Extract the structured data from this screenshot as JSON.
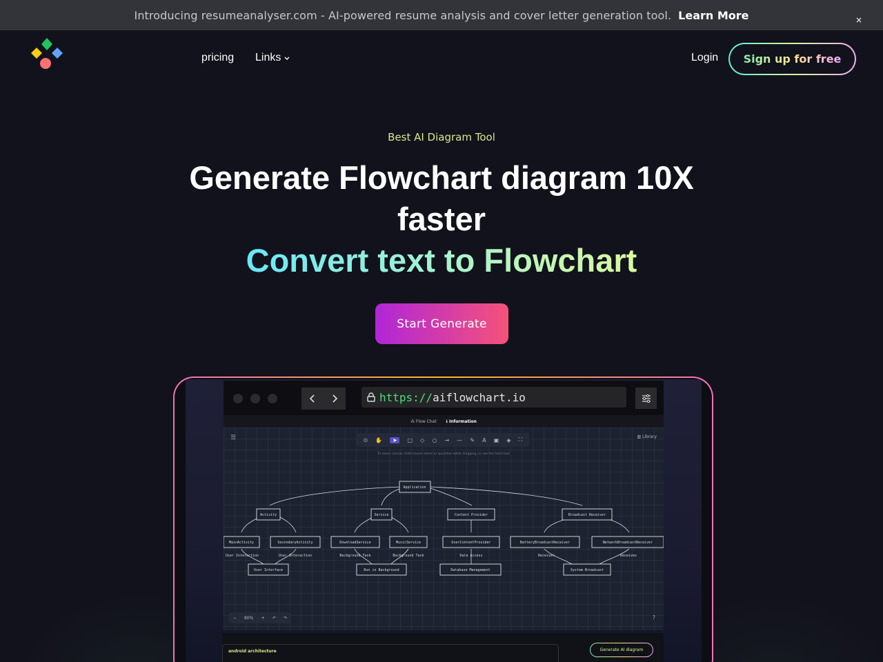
{
  "announcement": {
    "message": "Introducing resumeanalyser.com - AI-powered resume analysis and cover letter generation tool.",
    "link_label": "Learn More",
    "close_label": "×"
  },
  "nav": {
    "pricing_label": "pricing",
    "links_label": "Links",
    "links_chevron": "⌄",
    "login_label": "Login",
    "signup_label": "Sign up for free"
  },
  "hero": {
    "eyebrow": "Best AI Diagram Tool",
    "headline": "Generate Flowchart diagram 10X faster",
    "subheadline": "Convert text to Flowchart",
    "cta_label": "Start Generate"
  },
  "mockup": {
    "url_protocol": "https://",
    "url_host": "aiflowchart.io",
    "tabs": [
      {
        "label": "Flow Chat",
        "icon": "diagram-icon"
      },
      {
        "label": "Information",
        "icon": "info-icon",
        "active": true
      }
    ],
    "toolbar_icons": [
      "lock-icon",
      "hand-icon",
      "pointer-icon",
      "rectangle-icon",
      "diamond-icon",
      "ellipse-icon",
      "arrow-icon",
      "line-icon",
      "pencil-icon",
      "text-icon",
      "image-icon",
      "eraser-icon",
      "shapes-icon"
    ],
    "library_label": "Library",
    "hint": "To move canvas, hold mouse wheel or spacebar while dragging, or use the hand tool",
    "zoom_level": "80%",
    "prompt_text": "android architecture",
    "generate_label": "Generate AI diagram",
    "diagram": {
      "root": "Application",
      "level1": [
        "Activity",
        "Service",
        "Content Provider",
        "Broadcast Receiver"
      ],
      "level2": [
        "MainActivity",
        "SecondaryActivity",
        "DownloadService",
        "MusicService",
        "UserContentProvider",
        "BatteryBroadcastReceiver",
        "NetworkBroadcastReceiver"
      ],
      "edge_labels": [
        "User Interaction",
        "User Interaction",
        "Background Task",
        "Background Task",
        "Data Access",
        "Receives",
        "Receives"
      ],
      "level3": [
        "User Interface",
        "Run in Background",
        "Database Management",
        "System Broadcast"
      ]
    }
  },
  "colors": {
    "background": "#12121c",
    "announcement_bg": "#33343a",
    "eyebrow": "#d9e88a",
    "cta_start": "#b026d8",
    "cta_end": "#f5527a"
  }
}
